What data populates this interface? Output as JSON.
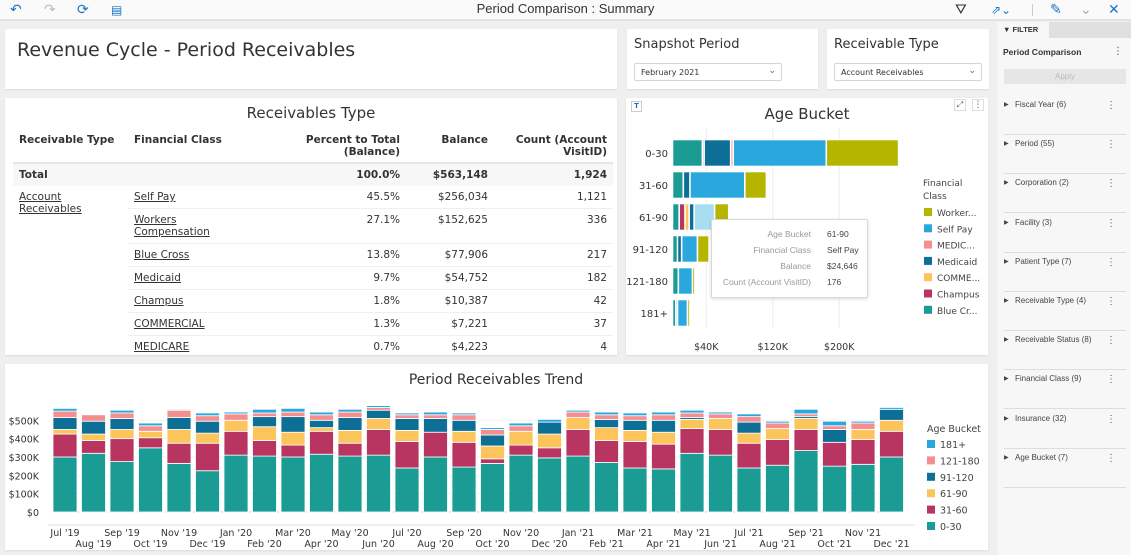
{
  "topbar": {
    "title": "Period Comparison : Summary",
    "icons": [
      "undo-icon",
      "redo-icon",
      "refresh-icon",
      "notes-icon",
      "filter-icon",
      "share-icon",
      "edit-icon",
      "collapse-icon",
      "close-icon"
    ]
  },
  "header": {
    "title": "Revenue Cycle - Period Receivables"
  },
  "snapshot": {
    "title": "Snapshot Period",
    "value": "February 2021"
  },
  "receivable_type": {
    "title": "Receivable Type",
    "value": "Account Receivables"
  },
  "table": {
    "title": "Receivables Type",
    "columns": [
      "Receivable Type",
      "Financial Class",
      "Percent to Total (Balance)",
      "Balance",
      "Count (Account VisitID)"
    ],
    "total": {
      "label": "Total",
      "percent": "100.0%",
      "balance": "$563,148",
      "count": "1,924"
    },
    "group": "Account Receivables",
    "rows": [
      {
        "class": "Self Pay",
        "percent": "45.5%",
        "balance": "$256,034",
        "count": "1,121"
      },
      {
        "class": "Workers Compensation",
        "percent": "27.1%",
        "balance": "$152,625",
        "count": "336"
      },
      {
        "class": "Blue Cross",
        "percent": "13.8%",
        "balance": "$77,906",
        "count": "217"
      },
      {
        "class": "Medicaid",
        "percent": "9.7%",
        "balance": "$54,752",
        "count": "182"
      },
      {
        "class": "Champus",
        "percent": "1.8%",
        "balance": "$10,387",
        "count": "42"
      },
      {
        "class": "COMMERCIAL",
        "percent": "1.3%",
        "balance": "$7,221",
        "count": "37"
      },
      {
        "class": "MEDICARE",
        "percent": "0.7%",
        "balance": "$4,223",
        "count": "4"
      }
    ]
  },
  "tooltip": {
    "rows": [
      {
        "k": "Age Bucket",
        "v": "61-90"
      },
      {
        "k": "Financial Class",
        "v": "Self Pay"
      },
      {
        "k": "Balance",
        "v": "$24,646"
      },
      {
        "k": "Count (Account VisitID)",
        "v": "176"
      }
    ]
  },
  "filter": {
    "tab": "FILTER",
    "title": "Period Comparison",
    "apply": "Apply",
    "items": [
      "Fiscal Year (6)",
      "Period (55)",
      "Corporation (2)",
      "Facility (3)",
      "Patient Type (7)",
      "Receivable Type (4)",
      "Receivable Status (8)",
      "Financial Class (9)",
      "Insurance (32)",
      "Age Bucket (7)"
    ]
  },
  "chart_data": [
    {
      "type": "bar",
      "orientation": "horizontal",
      "stacked": true,
      "title": "Age Bucket",
      "categories": [
        "0-30",
        "31-60",
        "61-90",
        "91-120",
        "121-180",
        "181+"
      ],
      "xticks": [
        "$40K",
        "$120K",
        "$200K"
      ],
      "xlim": [
        0,
        240000
      ],
      "legend_title": "Financial Class",
      "legend_position": "right",
      "series": [
        {
          "name": "Blue Cr...",
          "color": "#1a9b94",
          "values": [
            36000,
            13000,
            8000,
            6000,
            7000,
            4000
          ]
        },
        {
          "name": "Champus",
          "color": "#b83562",
          "values": [
            2000,
            0,
            7000,
            0,
            0,
            0
          ]
        },
        {
          "name": "COMME...",
          "color": "#fcc55b",
          "values": [
            0,
            0,
            5000,
            0,
            0,
            0
          ]
        },
        {
          "name": "Medicaid",
          "color": "#0e6f96",
          "values": [
            32000,
            8000,
            6000,
            5000,
            0,
            2000
          ]
        },
        {
          "name": "MEDIC...",
          "color": "#f58f8f",
          "values": [
            3000,
            0,
            0,
            0,
            0,
            0
          ]
        },
        {
          "name": "Self Pay",
          "color": "#2aa7dc",
          "values": [
            112000,
            66000,
            24646,
            19000,
            17000,
            12000
          ]
        },
        {
          "name": "Worker...",
          "color": "#b5b500",
          "values": [
            87000,
            26000,
            17000,
            14000,
            3000,
            3000
          ]
        }
      ]
    },
    {
      "type": "bar",
      "stacked": true,
      "title": "Period Receivables Trend",
      "ylabel": "",
      "xlabel": "",
      "ylim": [
        0,
        500000
      ],
      "yticks": [
        "$0",
        "$100K",
        "$200K",
        "$300K",
        "$400K",
        "$500K"
      ],
      "legend_title": "Age Bucket",
      "legend_position": "right",
      "categories": [
        "Jul '19",
        "Aug '19",
        "Sep '19",
        "Oct '19",
        "Nov '19",
        "Dec '19",
        "Jan '20",
        "Feb '20",
        "Mar '20",
        "Apr '20",
        "May '20",
        "Jun '20",
        "Jul '20",
        "Aug '20",
        "Sep '20",
        "Oct '20",
        "Nov '20",
        "Dec '20",
        "Jan '21",
        "Feb '21",
        "Mar '21",
        "Apr '21",
        "May '21",
        "Jun '21",
        "Jul '21",
        "Aug '21",
        "Sep '21",
        "Oct '21",
        "Nov '21",
        "Dec '21"
      ],
      "series": [
        {
          "name": "0-30",
          "color": "#1a9b94",
          "values": [
            300000,
            320000,
            275000,
            350000,
            265000,
            225000,
            310000,
            305000,
            300000,
            315000,
            305000,
            310000,
            240000,
            300000,
            245000,
            265000,
            310000,
            295000,
            305000,
            270000,
            240000,
            235000,
            320000,
            310000,
            240000,
            255000,
            335000,
            250000,
            260000,
            300000
          ]
        },
        {
          "name": "31-60",
          "color": "#b83562",
          "values": [
            125000,
            70000,
            125000,
            55000,
            110000,
            150000,
            130000,
            85000,
            65000,
            125000,
            70000,
            140000,
            145000,
            135000,
            135000,
            25000,
            55000,
            55000,
            145000,
            120000,
            145000,
            135000,
            135000,
            140000,
            135000,
            140000,
            115000,
            130000,
            135000,
            140000
          ]
        },
        {
          "name": "61-90",
          "color": "#fcc55b",
          "values": [
            25000,
            35000,
            50000,
            35000,
            75000,
            55000,
            60000,
            75000,
            70000,
            20000,
            70000,
            60000,
            60000,
            0,
            60000,
            70000,
            75000,
            75000,
            65000,
            70000,
            60000,
            65000,
            50000,
            60000,
            55000,
            60000,
            60000,
            0,
            55000,
            60000
          ]
        },
        {
          "name": "91-120",
          "color": "#0e6f96",
          "values": [
            65000,
            70000,
            60000,
            0,
            65000,
            65000,
            0,
            55000,
            85000,
            40000,
            70000,
            45000,
            65000,
            75000,
            60000,
            60000,
            0,
            65000,
            0,
            45000,
            55000,
            65000,
            10000,
            0,
            60000,
            0,
            10000,
            70000,
            0,
            60000
          ]
        },
        {
          "name": "121-180",
          "color": "#f58f8f",
          "values": [
            35000,
            35000,
            30000,
            30000,
            40000,
            30000,
            35000,
            20000,
            25000,
            30000,
            30000,
            15000,
            20000,
            20000,
            30000,
            30000,
            30000,
            0,
            30000,
            25000,
            25000,
            30000,
            25000,
            25000,
            30000,
            30000,
            15000,
            20000,
            35000,
            0
          ]
        },
        {
          "name": "181+",
          "color": "#2aa7dc",
          "values": [
            15000,
            0,
            15000,
            15000,
            5000,
            15000,
            10000,
            20000,
            20000,
            15000,
            15000,
            10000,
            10000,
            15000,
            10000,
            10000,
            15000,
            15000,
            10000,
            15000,
            15000,
            15000,
            15000,
            10000,
            15000,
            10000,
            25000,
            25000,
            10000,
            10000
          ]
        }
      ]
    }
  ]
}
